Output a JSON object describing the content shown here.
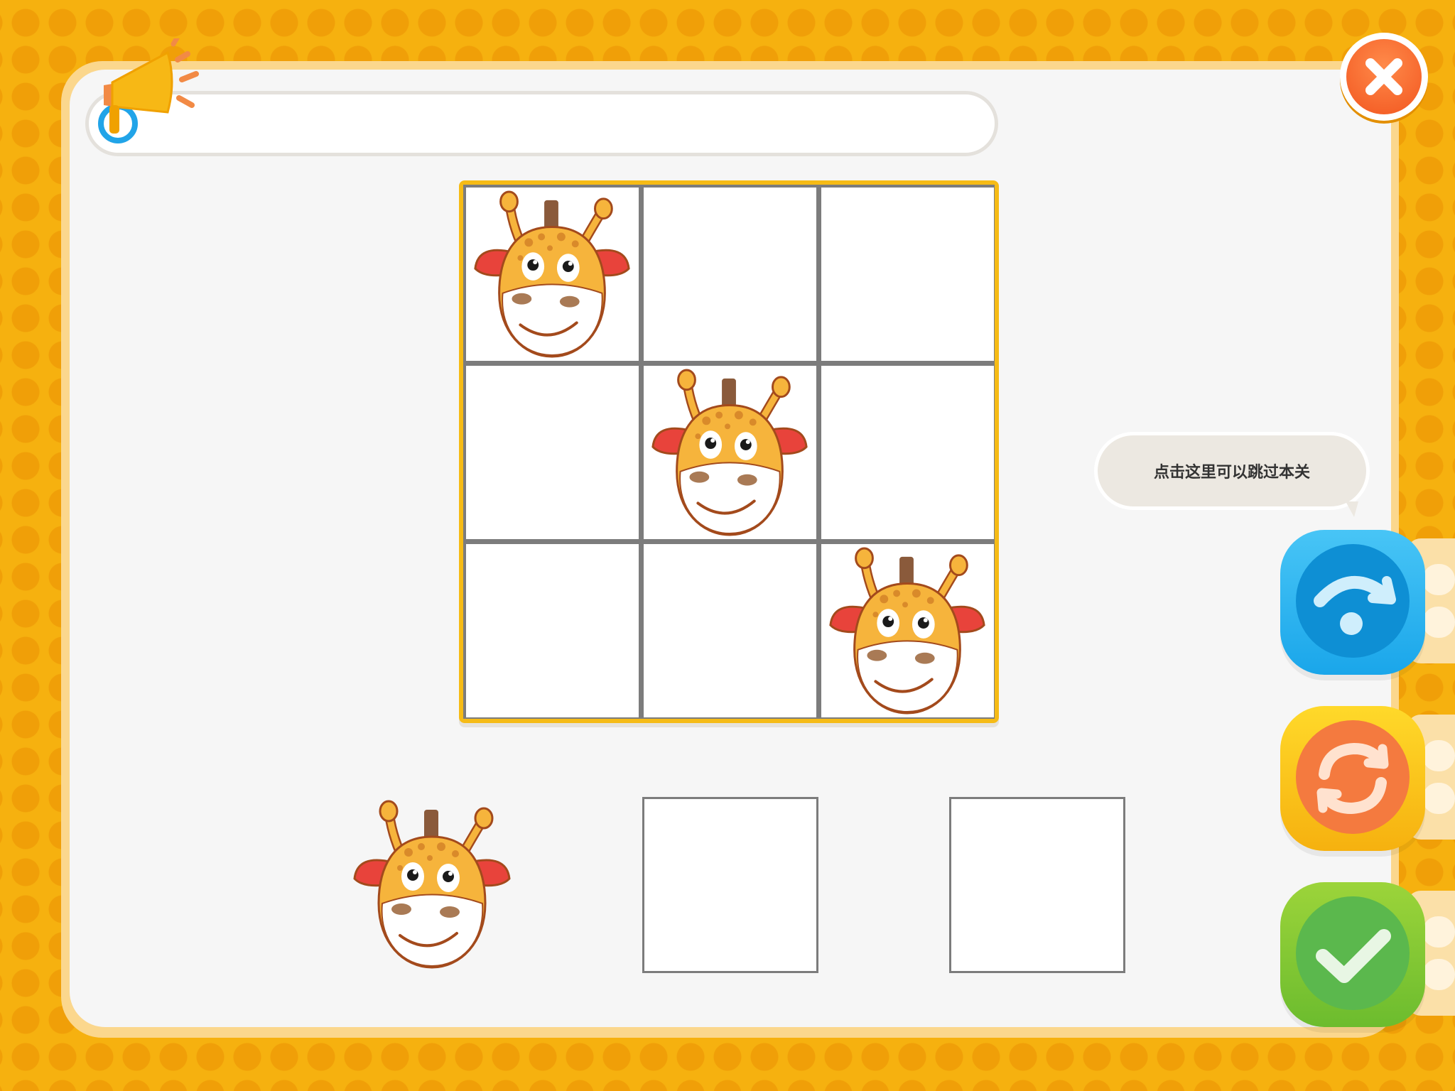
{
  "prompt": {
    "text": ""
  },
  "board": {
    "rows": 3,
    "cols": 3,
    "cells": [
      {
        "content": "giraffe-icon"
      },
      {
        "content": "empty"
      },
      {
        "content": "empty"
      },
      {
        "content": "empty"
      },
      {
        "content": "giraffe-icon"
      },
      {
        "content": "empty"
      },
      {
        "content": "empty"
      },
      {
        "content": "empty"
      },
      {
        "content": "giraffe-icon"
      }
    ]
  },
  "answer_options": [
    {
      "content": "giraffe-icon"
    },
    {
      "content": "empty"
    },
    {
      "content": "empty"
    }
  ],
  "skip_hint": {
    "text": "点击这里可以跳过本关"
  },
  "icons": {
    "audio": "megaphone-icon",
    "close": "close-icon",
    "skip": "skip-icon",
    "refresh": "refresh-icon",
    "submit": "check-icon"
  },
  "colors": {
    "background": "#f6b10f",
    "panel": "#f6f6f6",
    "skip": "#1aa6ea",
    "refresh": "#f47a3f",
    "submit": "#5bb84d",
    "close": "#f2561f"
  }
}
